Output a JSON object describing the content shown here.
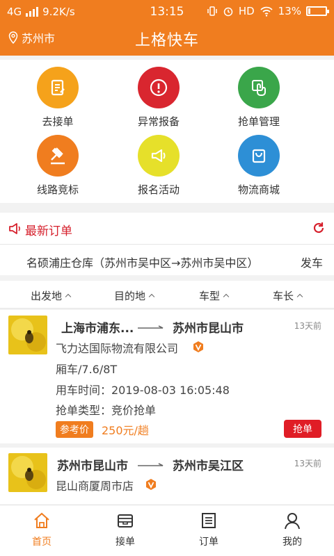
{
  "status_bar": {
    "network": "4G",
    "speed": "9.2K/s",
    "time": "13:15",
    "hd": "HD",
    "battery": "13%"
  },
  "header": {
    "city": "苏州市",
    "title": "上格快车",
    "brand_color": "#f07d1f"
  },
  "features": [
    {
      "label": "去接单",
      "icon": "clipboard-icon",
      "color": "#f5a21b"
    },
    {
      "label": "异常报备",
      "icon": "alert-icon",
      "color": "#d9262f"
    },
    {
      "label": "抢单管理",
      "icon": "hand-tap-icon",
      "color": "#3aa64a"
    },
    {
      "label": "线路竞标",
      "icon": "gavel-icon",
      "color": "#f07d1f"
    },
    {
      "label": "报名活动",
      "icon": "megaphone-icon",
      "color": "#e6e02a"
    },
    {
      "label": "物流商城",
      "icon": "shopping-bag-icon",
      "color": "#2d8fd6"
    }
  ],
  "latest": {
    "title": "最新订单",
    "route": "名硕浦庄仓库（苏州市吴中区→苏州市吴中区）",
    "action": "发车"
  },
  "filters": [
    "出发地",
    "目的地",
    "车型",
    "车长"
  ],
  "orders": [
    {
      "from": "上海市浦东...",
      "to": "苏州市昆山市",
      "time_ago": "13天前",
      "company": "飞力达国际物流有限公司",
      "vehicle": "厢车/7.6/8T",
      "use_time": "用车时间：2019-08-03 16:05:48",
      "grab_type": "抢单类型：竞价抢单",
      "price_tag": "参考价",
      "price": "250元/趟",
      "button": "抢单"
    },
    {
      "from": "苏州市昆山市",
      "to": "苏州市吴江区",
      "time_ago": "13天前",
      "company": "昆山商厦周市店"
    }
  ],
  "bottom_nav": [
    {
      "label": "首页",
      "icon": "home-icon",
      "active": true
    },
    {
      "label": "接单",
      "icon": "inbox-icon",
      "active": false
    },
    {
      "label": "订单",
      "icon": "list-icon",
      "active": false
    },
    {
      "label": "我的",
      "icon": "user-icon",
      "active": false
    }
  ]
}
